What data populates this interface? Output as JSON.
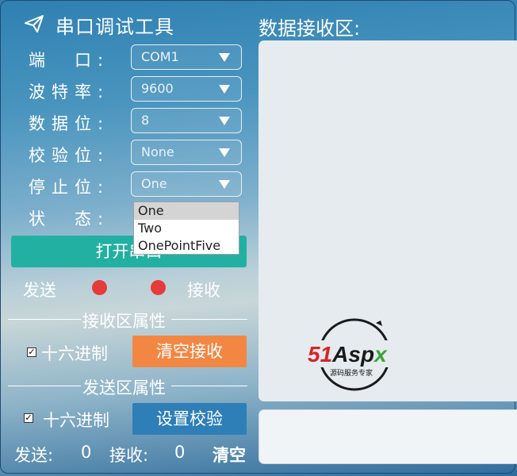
{
  "app": {
    "title": "串口调试工具"
  },
  "settings": {
    "port": {
      "label": "端　口:",
      "value": "COM1"
    },
    "baud": {
      "label": "波特率:",
      "value": "9600"
    },
    "data_bits": {
      "label": "数据位:",
      "value": "8"
    },
    "parity": {
      "label": "校验位:",
      "value": "None"
    },
    "stop_bits": {
      "label": "停止位:",
      "value": "One",
      "options": [
        "One",
        "Two",
        "OnePointFive"
      ]
    },
    "status": {
      "label": "状　态:"
    }
  },
  "open_button": {
    "label": "打开串口"
  },
  "indicators": {
    "send_label": "发送",
    "recv_label": "接收",
    "color": "#e53b3b"
  },
  "receive_section": {
    "title": "接收区属性",
    "hex_label": "十六进制",
    "hex_checked": true,
    "clear_label": "清空接收"
  },
  "send_section": {
    "title": "发送区属性",
    "hex_label": "十六进制",
    "hex_checked": true,
    "verify_label": "设置校验"
  },
  "counters": {
    "send_label": "发送:",
    "send_value": "0",
    "recv_label": "接收:",
    "recv_value": "0",
    "clear_label": "清空"
  },
  "receive_area": {
    "title": "数据接收区:"
  },
  "watermark": {
    "brand": "51Aspx",
    "tagline": "源码服务专家"
  },
  "colors": {
    "open_button": "#22b0a2",
    "clear_button": "#f28744",
    "verify_button": "#2e7fb8"
  }
}
